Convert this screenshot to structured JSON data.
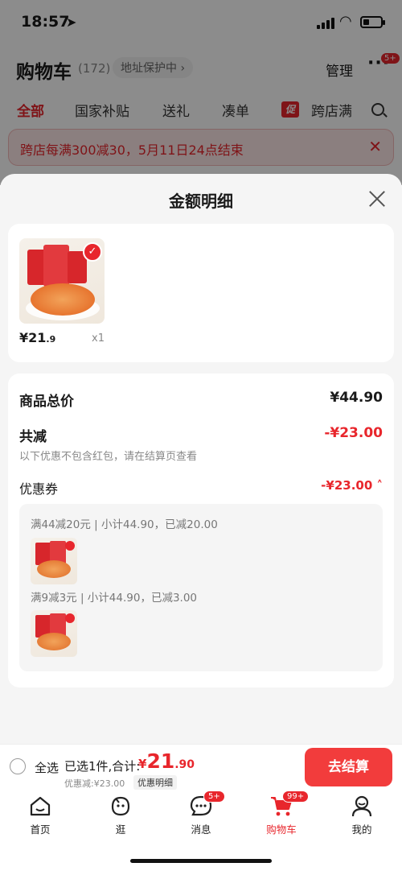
{
  "status_bar": {
    "time": "18:57"
  },
  "header": {
    "title": "购物车",
    "count": "(172)",
    "address": "地址保护中 ›",
    "manage": "管理",
    "more_badge": "5+"
  },
  "tabs": [
    {
      "label": "全部"
    },
    {
      "label": "国家补贴"
    },
    {
      "label": "送礼"
    },
    {
      "label": "凑单"
    },
    {
      "label": "跨店满"
    }
  ],
  "promo_tag": "促",
  "banner": {
    "text": "跨店每满300减30，5月11日24点结束"
  },
  "sheet": {
    "title": "金额明细",
    "product": {
      "price_main": "¥21",
      "price_decimal": ".9",
      "quantity": "x1"
    },
    "summary": {
      "total_label": "商品总价",
      "total_value": "¥44.90",
      "reduce_label": "共减",
      "reduce_value": "-¥23.00",
      "note": "以下优惠不包含红包，请在结算页查看",
      "coupon_label": "优惠券",
      "coupon_value": "-¥23.00 ˄"
    },
    "coupon_details": [
      {
        "text": "满44减20元 | 小计44.90，已减20.00"
      },
      {
        "text": "满9减3元 | 小计44.90，已减3.00"
      }
    ]
  },
  "checkout": {
    "select_all": "全选",
    "selected_info": "已选1件,合计:",
    "total_currency": "¥",
    "total_main": "21",
    "total_decimal": ".90",
    "discount": "优惠减:¥23.00",
    "detail": "优惠明细",
    "pay": "去结算"
  },
  "nav": [
    {
      "label": "首页",
      "icon": "home-icon"
    },
    {
      "label": "逛",
      "icon": "browse-icon"
    },
    {
      "label": "消息",
      "icon": "message-icon",
      "badge": "5+"
    },
    {
      "label": "购物车",
      "icon": "cart-icon",
      "badge": "99+"
    },
    {
      "label": "我的",
      "icon": "profile-icon"
    }
  ],
  "colors": {
    "accent": "#e8262c",
    "pay_button": "#f23c3c"
  }
}
